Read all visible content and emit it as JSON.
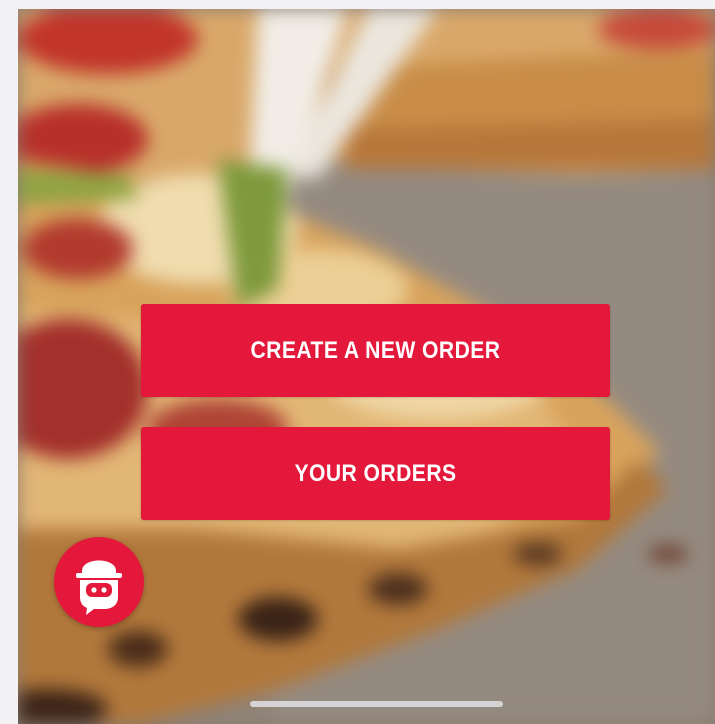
{
  "theme": {
    "accent": "#e3183a",
    "button_text_color": "#ffffff"
  },
  "background": {
    "image": "blurred close-up of a pizza slice being lifted with stretched cheese"
  },
  "actions": {
    "create_order_label": "CREATE A NEW ORDER",
    "your_orders_label": "YOUR ORDERS"
  },
  "chat": {
    "icon": "delivery-mascot-chat-icon"
  },
  "system": {
    "home_indicator": "home-indicator"
  }
}
